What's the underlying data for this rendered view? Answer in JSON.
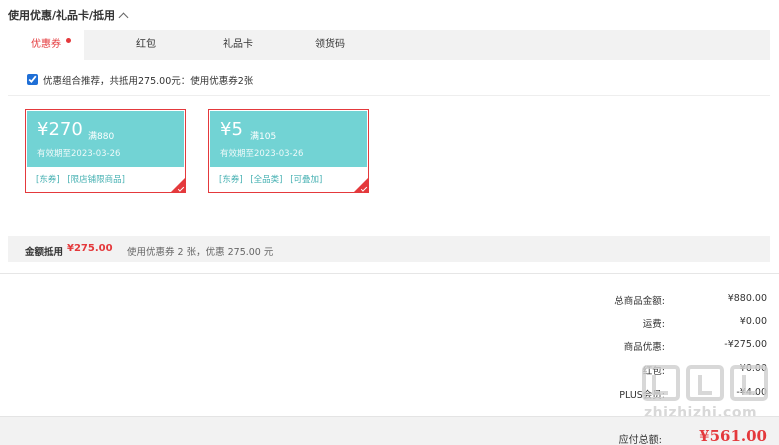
{
  "section": {
    "title": "使用优惠/礼品卡/抵用"
  },
  "tabs": [
    {
      "label": "优惠券",
      "active": true,
      "dot": true
    },
    {
      "label": "红包",
      "active": false
    },
    {
      "label": "礼品卡",
      "active": false
    },
    {
      "label": "领货码",
      "active": false
    }
  ],
  "combo": {
    "checked": true,
    "text": "优惠组合推荐，共抵用275.00元：使用优惠券2张"
  },
  "coupons": [
    {
      "amount": "¥270",
      "condition": "满880",
      "valid": "有效期至2023-03-26",
      "tags": [
        "[东券]",
        "[限店铺限商品]"
      ]
    },
    {
      "amount": "¥5",
      "condition": "满105",
      "valid": "有效期至2023-03-26",
      "tags": [
        "[东券]",
        "[全品类]",
        "[可叠加]"
      ]
    }
  ],
  "summary": {
    "label": "金额抵用",
    "amount": "¥275.00",
    "desc": "使用优惠券 2 张，优惠 275.00 元"
  },
  "totals": [
    {
      "label": "总商品金额:",
      "value": "¥880.00"
    },
    {
      "label": "运费:",
      "value": "¥0.00"
    },
    {
      "label": "商品优惠:",
      "value": "-¥275.00"
    },
    {
      "label": "红包:",
      "value": "¥0.00"
    },
    {
      "label": "PLUS会员:",
      "value": "-¥4.00"
    }
  ],
  "payable": {
    "label": "应付总额:",
    "value": "¥561.00"
  },
  "watermark": {
    "text": "zhizhizhi.com"
  },
  "colors": {
    "accent": "#e4393c",
    "coupon": "#72d3d4",
    "tag": "#45b0b2"
  },
  "icons": {
    "collapse": "chevron-up-icon",
    "selected": "check-corner-icon",
    "watermark": "watermark-logo"
  }
}
